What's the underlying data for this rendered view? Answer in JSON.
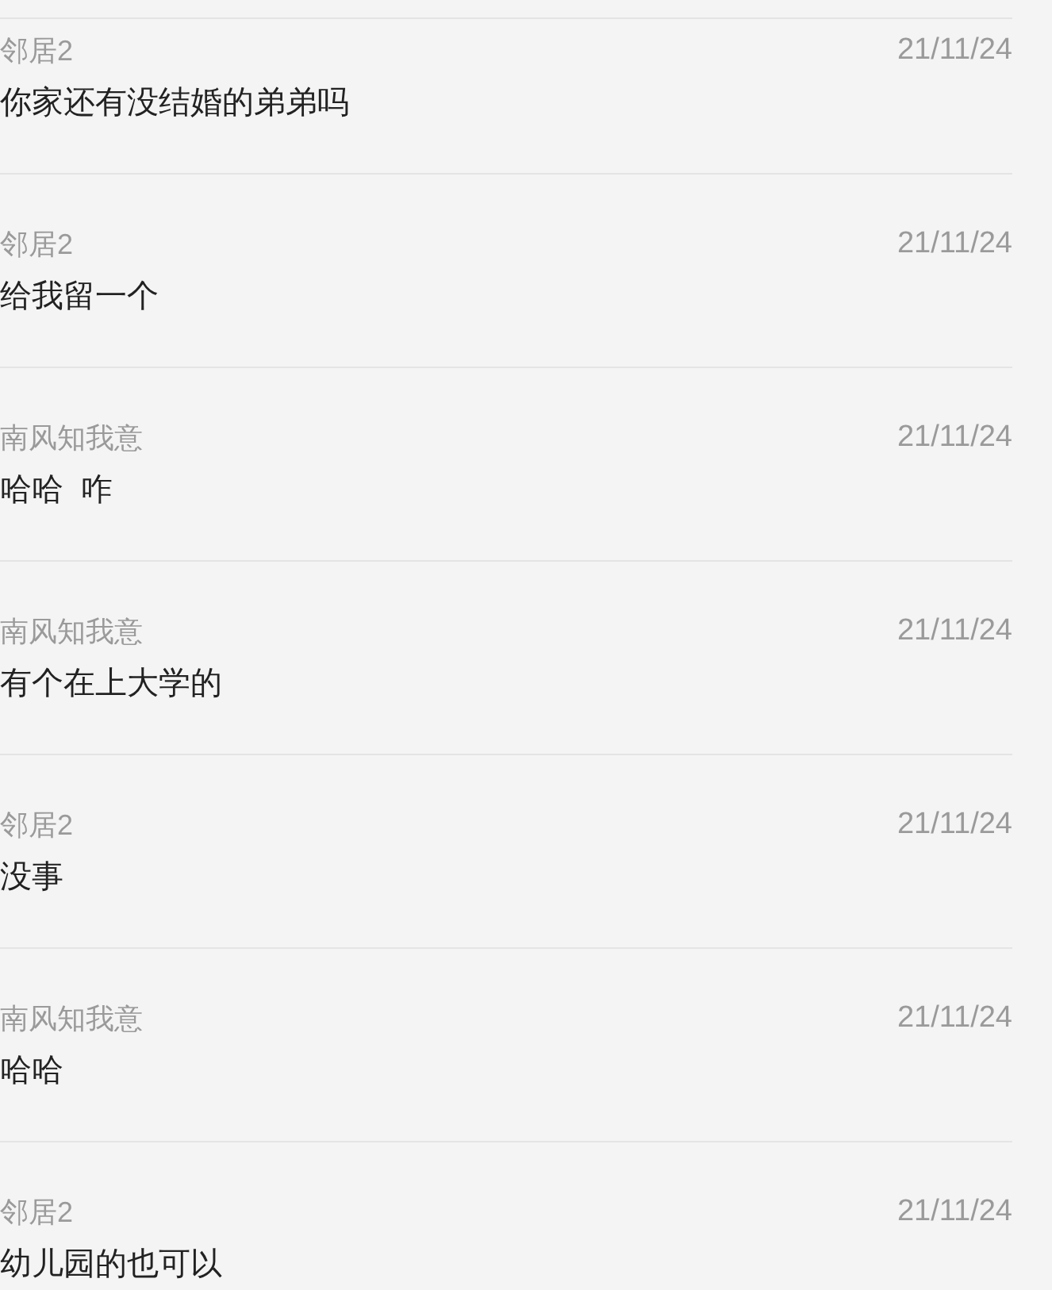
{
  "comments": [
    {
      "author": "邻居2",
      "date": "21/11/24",
      "text": "你家还有没结婚的弟弟吗"
    },
    {
      "author": "邻居2",
      "date": "21/11/24",
      "text": "给我留一个"
    },
    {
      "author": "南风知我意",
      "date": "21/11/24",
      "text": "哈哈  咋"
    },
    {
      "author": "南风知我意",
      "date": "21/11/24",
      "text": "有个在上大学的"
    },
    {
      "author": "邻居2",
      "date": "21/11/24",
      "text": "没事"
    },
    {
      "author": "南风知我意",
      "date": "21/11/24",
      "text": "哈哈"
    },
    {
      "author": "邻居2",
      "date": "21/11/24",
      "text": "幼儿园的也可以"
    }
  ]
}
